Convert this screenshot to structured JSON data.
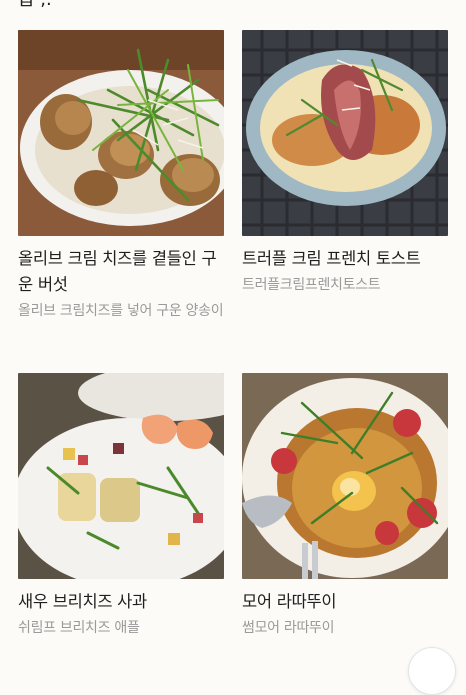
{
  "header": {
    "cut_text": "급 ,."
  },
  "menu_items": [
    {
      "title": "올리브 크림 치즈를 곁들인 구운 버섯",
      "description": "올리브 크림치즈를 넣어 구운 양송이"
    },
    {
      "title": "트러플 크림 프렌치 토스트",
      "description": "트러플크림프렌치토스트"
    },
    {
      "title": "새우 브리치즈 사과",
      "description": "쉬림프 브리치즈 애플"
    },
    {
      "title": "모어 라따뚜이",
      "description": "썸모어 라따뚜이"
    }
  ]
}
